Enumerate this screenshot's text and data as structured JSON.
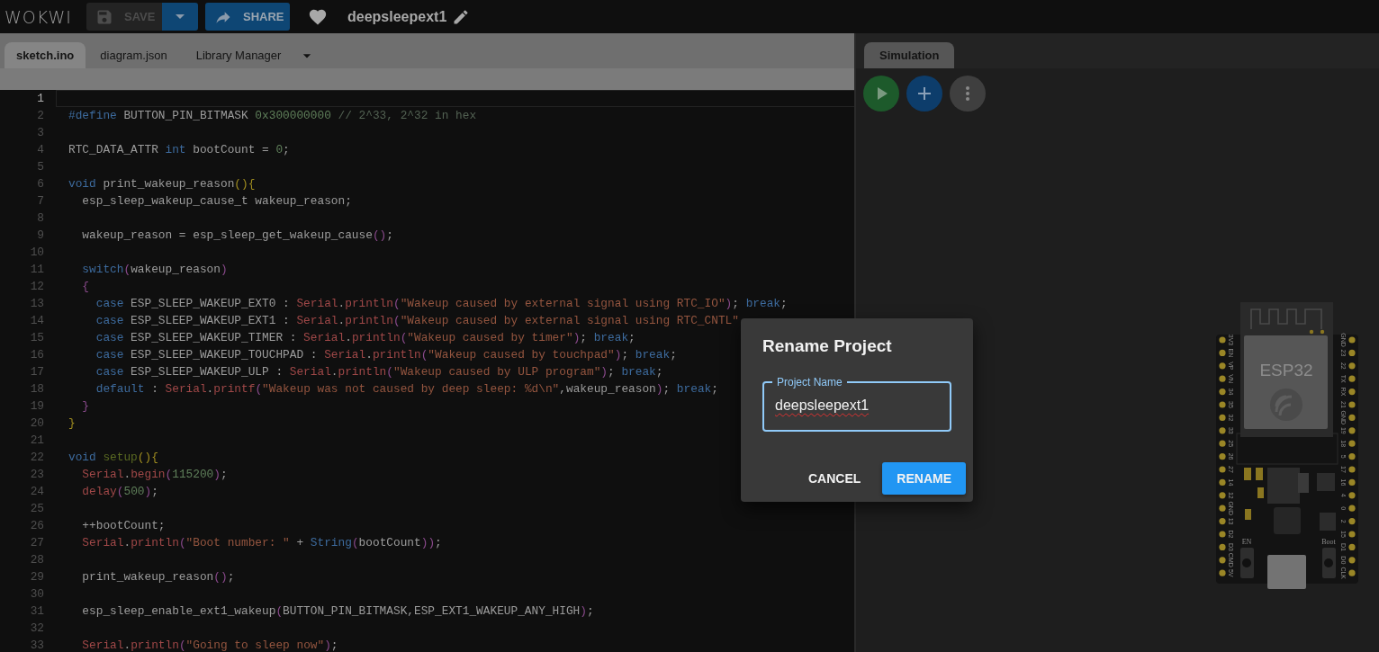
{
  "header": {
    "logo": "WOKWI",
    "save": {
      "label": "SAVE",
      "disabled": true
    },
    "share": {
      "label": "SHARE"
    },
    "project_title": "deepsleepext1"
  },
  "editor": {
    "tabs": [
      {
        "label": "sketch.ino",
        "selected": true
      },
      {
        "label": "diagram.json",
        "selected": false
      },
      {
        "label": "Library Manager",
        "selected": false
      }
    ],
    "lines": [
      {
        "number": "1",
        "current": true
      },
      {
        "number": "2",
        "current": false,
        "tokens": [
          {
            "kind": "keyword",
            "text": "#define"
          },
          {
            "kind": "plain",
            "text": " BUTTON_PIN_BITMASK "
          },
          {
            "kind": "number",
            "text": "0x300000000"
          },
          {
            "kind": "comment",
            "text": " // 2^33, 2^32 in hex"
          }
        ]
      },
      {
        "number": "3",
        "current": false
      },
      {
        "number": "4",
        "current": false,
        "tokens": [
          {
            "kind": "plain",
            "text": "RTC_DATA_ATTR "
          },
          {
            "kind": "keyword",
            "text": "int"
          },
          {
            "kind": "plain",
            "text": " bootCount = "
          },
          {
            "kind": "number",
            "text": "0"
          },
          {
            "kind": "plain",
            "text": ";"
          }
        ]
      },
      {
        "number": "5",
        "current": false
      },
      {
        "number": "6",
        "current": false,
        "tokens": [
          {
            "kind": "keyword",
            "text": "void"
          },
          {
            "kind": "plain",
            "text": " print_wakeup_reason"
          },
          {
            "kind": "brace",
            "text": "(){"
          }
        ]
      },
      {
        "number": "7",
        "current": false,
        "tokens": [
          {
            "kind": "plain",
            "text": "  esp_sleep_wakeup_cause_t wakeup_reason;"
          }
        ]
      },
      {
        "number": "8",
        "current": false
      },
      {
        "number": "9",
        "current": false,
        "tokens": [
          {
            "kind": "plain",
            "text": "  wakeup_reason = esp_sleep_get_wakeup_cause"
          },
          {
            "kind": "paren",
            "text": "()"
          },
          {
            "kind": "plain",
            "text": ";"
          }
        ]
      },
      {
        "number": "10",
        "current": false
      },
      {
        "number": "11",
        "current": false,
        "tokens": [
          {
            "kind": "keyword",
            "text": "  switch"
          },
          {
            "kind": "paren",
            "text": "("
          },
          {
            "kind": "plain",
            "text": "wakeup_reason"
          },
          {
            "kind": "paren",
            "text": ")"
          }
        ]
      },
      {
        "number": "12",
        "current": false,
        "tokens": [
          {
            "kind": "paren",
            "text": "  {"
          }
        ]
      },
      {
        "number": "13",
        "current": false,
        "tokens": [
          {
            "kind": "keyword",
            "text": "    case"
          },
          {
            "kind": "plain",
            "text": " ESP_SLEEP_WAKEUP_EXT0 : "
          },
          {
            "kind": "call",
            "text": "Serial"
          },
          {
            "kind": "plain",
            "text": "."
          },
          {
            "kind": "call",
            "text": "println"
          },
          {
            "kind": "paren",
            "text": "("
          },
          {
            "kind": "string",
            "text": "\"Wakeup caused by external signal using RTC_IO\""
          },
          {
            "kind": "paren",
            "text": ")"
          },
          {
            "kind": "plain",
            "text": "; "
          },
          {
            "kind": "keyword",
            "text": "break"
          },
          {
            "kind": "plain",
            "text": ";"
          }
        ]
      },
      {
        "number": "14",
        "current": false,
        "tokens": [
          {
            "kind": "keyword",
            "text": "    case"
          },
          {
            "kind": "plain",
            "text": " ESP_SLEEP_WAKEUP_EXT1 : "
          },
          {
            "kind": "call",
            "text": "Serial"
          },
          {
            "kind": "plain",
            "text": "."
          },
          {
            "kind": "call",
            "text": "println"
          },
          {
            "kind": "paren",
            "text": "("
          },
          {
            "kind": "string",
            "text": "\"Wakeup caused by external signal using RTC_CNTL\""
          }
        ]
      },
      {
        "number": "15",
        "current": false,
        "tokens": [
          {
            "kind": "keyword",
            "text": "    case"
          },
          {
            "kind": "plain",
            "text": " ESP_SLEEP_WAKEUP_TIMER : "
          },
          {
            "kind": "call",
            "text": "Serial"
          },
          {
            "kind": "plain",
            "text": "."
          },
          {
            "kind": "call",
            "text": "println"
          },
          {
            "kind": "paren",
            "text": "("
          },
          {
            "kind": "string",
            "text": "\"Wakeup caused by timer\""
          },
          {
            "kind": "paren",
            "text": ")"
          },
          {
            "kind": "plain",
            "text": "; "
          },
          {
            "kind": "keyword",
            "text": "break"
          },
          {
            "kind": "plain",
            "text": ";"
          }
        ]
      },
      {
        "number": "16",
        "current": false,
        "tokens": [
          {
            "kind": "keyword",
            "text": "    case"
          },
          {
            "kind": "plain",
            "text": " ESP_SLEEP_WAKEUP_TOUCHPAD : "
          },
          {
            "kind": "call",
            "text": "Serial"
          },
          {
            "kind": "plain",
            "text": "."
          },
          {
            "kind": "call",
            "text": "println"
          },
          {
            "kind": "paren",
            "text": "("
          },
          {
            "kind": "string",
            "text": "\"Wakeup caused by touchpad\""
          },
          {
            "kind": "paren",
            "text": ")"
          },
          {
            "kind": "plain",
            "text": "; "
          },
          {
            "kind": "keyword",
            "text": "break"
          },
          {
            "kind": "plain",
            "text": ";"
          }
        ]
      },
      {
        "number": "17",
        "current": false,
        "tokens": [
          {
            "kind": "keyword",
            "text": "    case"
          },
          {
            "kind": "plain",
            "text": " ESP_SLEEP_WAKEUP_ULP : "
          },
          {
            "kind": "call",
            "text": "Serial"
          },
          {
            "kind": "plain",
            "text": "."
          },
          {
            "kind": "call",
            "text": "println"
          },
          {
            "kind": "paren",
            "text": "("
          },
          {
            "kind": "string",
            "text": "\"Wakeup caused by ULP program\""
          },
          {
            "kind": "paren",
            "text": ")"
          },
          {
            "kind": "plain",
            "text": "; "
          },
          {
            "kind": "keyword",
            "text": "break"
          },
          {
            "kind": "plain",
            "text": ";"
          }
        ]
      },
      {
        "number": "18",
        "current": false,
        "tokens": [
          {
            "kind": "keyword",
            "text": "    default"
          },
          {
            "kind": "plain",
            "text": " : "
          },
          {
            "kind": "call",
            "text": "Serial"
          },
          {
            "kind": "plain",
            "text": "."
          },
          {
            "kind": "call",
            "text": "printf"
          },
          {
            "kind": "paren",
            "text": "("
          },
          {
            "kind": "string",
            "text": "\"Wakeup was not caused by deep sleep: %d\\n\""
          },
          {
            "kind": "plain",
            "text": ",wakeup_reason"
          },
          {
            "kind": "paren",
            "text": ")"
          },
          {
            "kind": "plain",
            "text": "; "
          },
          {
            "kind": "keyword",
            "text": "break"
          },
          {
            "kind": "plain",
            "text": ";"
          }
        ]
      },
      {
        "number": "19",
        "current": false,
        "tokens": [
          {
            "kind": "paren",
            "text": "  }"
          }
        ]
      },
      {
        "number": "20",
        "current": false,
        "tokens": [
          {
            "kind": "brace",
            "text": "}"
          }
        ]
      },
      {
        "number": "21",
        "current": false
      },
      {
        "number": "22",
        "current": false,
        "tokens": [
          {
            "kind": "keyword",
            "text": "void "
          },
          {
            "kind": "name",
            "text": "setup"
          },
          {
            "kind": "brace",
            "text": "(){"
          }
        ]
      },
      {
        "number": "23",
        "current": false,
        "tokens": [
          {
            "kind": "call",
            "text": "  Serial"
          },
          {
            "kind": "plain",
            "text": "."
          },
          {
            "kind": "call",
            "text": "begin"
          },
          {
            "kind": "paren",
            "text": "("
          },
          {
            "kind": "number",
            "text": "115200"
          },
          {
            "kind": "paren",
            "text": ")"
          },
          {
            "kind": "plain",
            "text": ";"
          }
        ]
      },
      {
        "number": "24",
        "current": false,
        "tokens": [
          {
            "kind": "call",
            "text": "  delay"
          },
          {
            "kind": "paren",
            "text": "("
          },
          {
            "kind": "number",
            "text": "500"
          },
          {
            "kind": "paren",
            "text": ")"
          },
          {
            "kind": "plain",
            "text": ";"
          }
        ]
      },
      {
        "number": "25",
        "current": false
      },
      {
        "number": "26",
        "current": false,
        "tokens": [
          {
            "kind": "plain",
            "text": "  ++bootCount;"
          }
        ]
      },
      {
        "number": "27",
        "current": false,
        "tokens": [
          {
            "kind": "call",
            "text": "  Serial"
          },
          {
            "kind": "plain",
            "text": "."
          },
          {
            "kind": "call",
            "text": "println"
          },
          {
            "kind": "paren",
            "text": "("
          },
          {
            "kind": "string",
            "text": "\"Boot number: \""
          },
          {
            "kind": "plain",
            "text": " + "
          },
          {
            "kind": "keyword",
            "text": "String"
          },
          {
            "kind": "paren",
            "text": "("
          },
          {
            "kind": "plain",
            "text": "bootCount"
          },
          {
            "kind": "paren",
            "text": "))"
          },
          {
            "kind": "plain",
            "text": ";"
          }
        ]
      },
      {
        "number": "28",
        "current": false
      },
      {
        "number": "29",
        "current": false,
        "tokens": [
          {
            "kind": "plain",
            "text": "  print_wakeup_reason"
          },
          {
            "kind": "paren",
            "text": "()"
          },
          {
            "kind": "plain",
            "text": ";"
          }
        ]
      },
      {
        "number": "30",
        "current": false
      },
      {
        "number": "31",
        "current": false,
        "tokens": [
          {
            "kind": "plain",
            "text": "  esp_sleep_enable_ext1_wakeup"
          },
          {
            "kind": "paren",
            "text": "("
          },
          {
            "kind": "plain",
            "text": "BUTTON_PIN_BITMASK,ESP_EXT1_WAKEUP_ANY_HIGH"
          },
          {
            "kind": "paren",
            "text": ")"
          },
          {
            "kind": "plain",
            "text": ";"
          }
        ]
      },
      {
        "number": "32",
        "current": false
      },
      {
        "number": "33",
        "current": false,
        "tokens": [
          {
            "kind": "call",
            "text": "  Serial"
          },
          {
            "kind": "plain",
            "text": "."
          },
          {
            "kind": "call",
            "text": "println"
          },
          {
            "kind": "paren",
            "text": "("
          },
          {
            "kind": "string",
            "text": "\"Going to sleep now\""
          },
          {
            "kind": "paren",
            "text": ")"
          },
          {
            "kind": "plain",
            "text": ";"
          }
        ]
      }
    ]
  },
  "simulation": {
    "tab": "Simulation",
    "board": {
      "chip": "ESP32",
      "left_pins": [
        "3V3",
        "EN",
        "VP",
        "VN",
        "34",
        "35",
        "32",
        "33",
        "25",
        "26",
        "27",
        "14",
        "12",
        "GND",
        "13",
        "D2",
        "D3",
        "CMD",
        "5V"
      ],
      "right_pins": [
        "GND",
        "23",
        "22",
        "TX",
        "RX",
        "21",
        "GND",
        "19",
        "18",
        "5",
        "17",
        "16",
        "4",
        "0",
        "2",
        "15",
        "D1",
        "D0",
        "CLK"
      ],
      "buttons": [
        "EN",
        "Boot"
      ]
    }
  },
  "dialog": {
    "title": "Rename Project",
    "field": {
      "label": "Project Name",
      "value": "deepsleepext1",
      "misspelled": true
    },
    "buttons": [
      {
        "kind": "text",
        "label": "CANCEL"
      },
      {
        "kind": "primary",
        "label": "RENAME"
      }
    ]
  }
}
